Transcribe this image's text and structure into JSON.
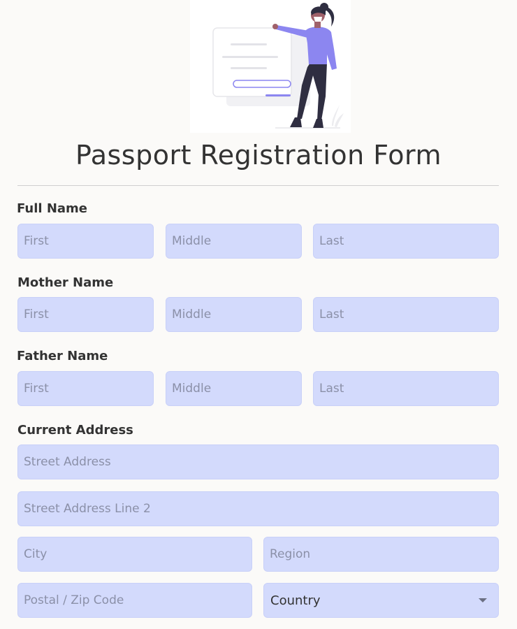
{
  "form": {
    "title": "Passport Registration Form",
    "full_name": {
      "label": "Full Name",
      "first_placeholder": "First",
      "middle_placeholder": "Middle",
      "last_placeholder": "Last"
    },
    "mother_name": {
      "label": "Mother Name",
      "first_placeholder": "First",
      "middle_placeholder": "Middle",
      "last_placeholder": "Last"
    },
    "father_name": {
      "label": "Father Name",
      "first_placeholder": "First",
      "middle_placeholder": "Middle",
      "last_placeholder": "Last"
    },
    "current_address": {
      "label": "Current Address",
      "street_placeholder": "Street Address",
      "street2_placeholder": "Street Address Line 2",
      "city_placeholder": "City",
      "region_placeholder": "Region",
      "postal_placeholder": "Postal / Zip Code",
      "country_selected": "Country"
    }
  },
  "icons": {
    "country_dropdown": "chevron-down-icon"
  },
  "colors": {
    "field_background": "#d3dafc",
    "accent_purple": "#8c86f0",
    "page_background": "#fbfaf8"
  }
}
